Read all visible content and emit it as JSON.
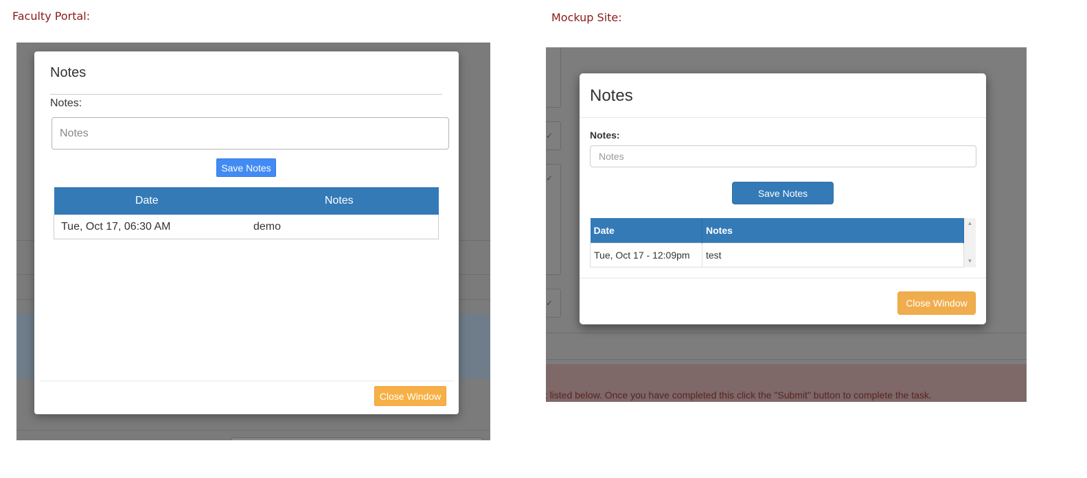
{
  "captions": {
    "left": "Faculty Portal:",
    "right": "Mockup Site:"
  },
  "faculty_portal": {
    "modal": {
      "title": "Notes",
      "notes_label": "Notes:",
      "notes_input": {
        "placeholder": "Notes",
        "value": ""
      },
      "save_button": "Save Notes",
      "table": {
        "headers": [
          "Date",
          "Notes"
        ],
        "rows": [
          {
            "date": "Tue, Oct 17, 06:30 AM",
            "notes": "demo"
          }
        ]
      },
      "close_button": "Close Window"
    },
    "colors": {
      "primary": "#428bf4",
      "header": "#337ab7",
      "warning": "#f7b046",
      "overlay": "#7b7b7b"
    }
  },
  "mockup_site": {
    "modal": {
      "title": "Notes",
      "notes_label": "Notes:",
      "notes_input": {
        "placeholder": "Notes",
        "value": ""
      },
      "save_button": "Save Notes",
      "table": {
        "headers": [
          "Date",
          "Notes"
        ],
        "rows": [
          {
            "date": "Tue, Oct 17 - 12:09pm",
            "notes": "test"
          }
        ]
      },
      "close_button": "Close Window"
    },
    "background_instruction": "nt listed below. Once you have completed this click the \"Submit\" button to complete the task.",
    "colors": {
      "primary": "#337ab7",
      "warning": "#f0ad4e",
      "overlay": "#7d7d7d"
    }
  }
}
